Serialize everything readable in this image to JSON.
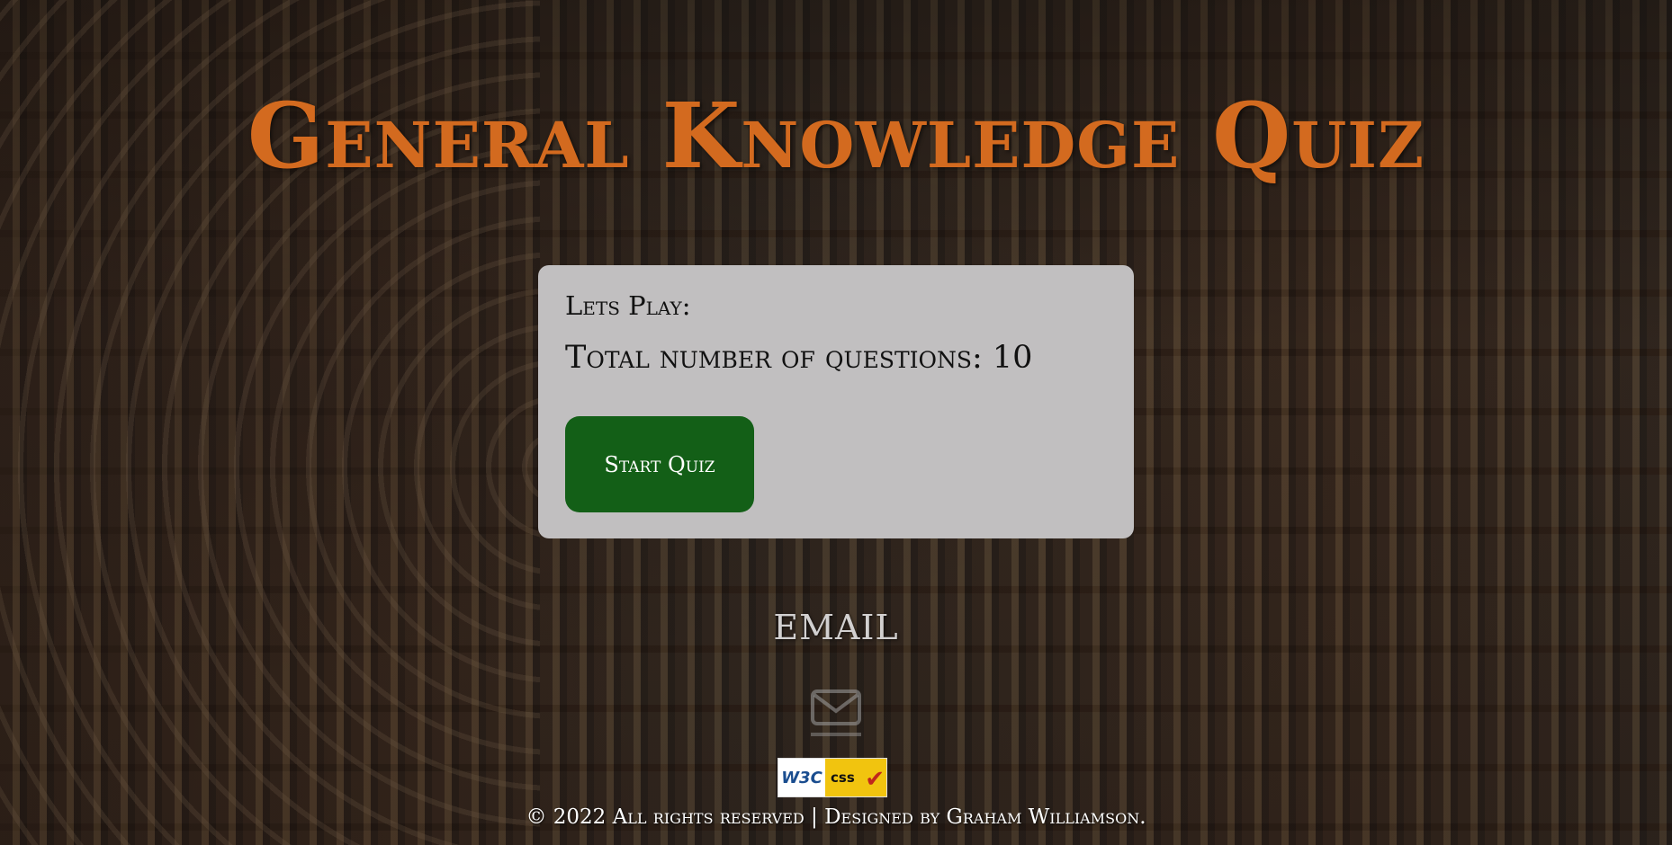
{
  "header": {
    "title": "General Knowledge Quiz"
  },
  "card": {
    "lets_play": "Lets Play:",
    "total_label": "Total number of questions: 10",
    "start_button": "Start Quiz"
  },
  "contact": {
    "email_label": "EMAIL",
    "email_icon": "envelope-icon"
  },
  "badge": {
    "w3c_text": "W3C",
    "css_text": "css",
    "check_icon": "checkmark-icon"
  },
  "footer": {
    "text": "© 2022 All rights reserved | Designed by Graham Williamson."
  },
  "colors": {
    "title": "#d36a1f",
    "card_background": "#c1bfc0",
    "start_button": "#135f17",
    "email_label": "#d2d0d0"
  }
}
